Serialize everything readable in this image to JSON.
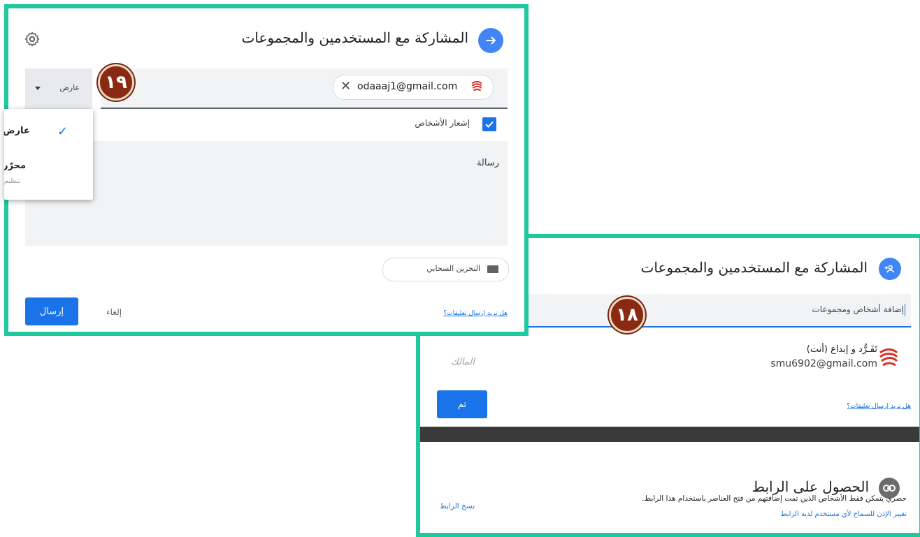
{
  "front": {
    "title": "المشاركة مع المستخدمين والمجموعات",
    "role_selector": {
      "value": "عارض"
    },
    "chip": {
      "email": "odaaaj1@gmail.com"
    },
    "notify": {
      "label": "إشعار الأشخاص",
      "checked": true
    },
    "message": {
      "placeholder": "رسالة"
    },
    "dropdown": [
      {
        "label": "عارض",
        "selected": true,
        "desc": ""
      },
      {
        "label": "محرّر",
        "selected": false,
        "desc": "تنظيم الملفات"
      }
    ],
    "storage_chip": {
      "label": "التخزين السحابي"
    },
    "feedback_link": "هل تريد إرسال تعليقات؟",
    "cancel_label": "إلغاء",
    "send_label": "إرسال",
    "badge": "١٩"
  },
  "back": {
    "title": "المشاركة مع المستخدمين والمجموعات",
    "add_placeholder": "إضافة أشخاص ومجموعات",
    "owner": {
      "name": "تَفَـرُّد و إبداع (أنت)",
      "email": "smu6902@gmail.com",
      "role": "المالك"
    },
    "feedback_link": "هل تريد إرسال تعليقات؟",
    "done_label": "تم",
    "badge": "١٨",
    "link_section": {
      "title": "الحصول على الرابط",
      "desc": "حصري يتمكن فقط الأشخاص الذين تمت إضافتهم من فتح العناصر باستخدام هذا الرابط.",
      "change_link": "تغيير الإذن للسماح لأي مستخدم لديه الرابط",
      "copy_link": "نسخ الرابط"
    }
  },
  "colors": {
    "frame": "#1ec99e",
    "accent": "#1a73e8",
    "badge": "#8b2a12"
  }
}
